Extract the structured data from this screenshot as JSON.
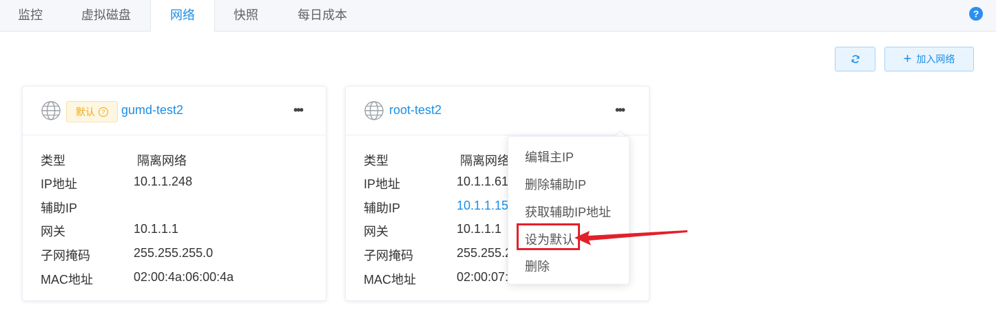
{
  "tabs": [
    {
      "label": "监控",
      "active": false
    },
    {
      "label": "虚拟磁盘",
      "active": false
    },
    {
      "label": "网络",
      "active": true
    },
    {
      "label": "快照",
      "active": false
    },
    {
      "label": "每日成本",
      "active": false
    }
  ],
  "help_icon": "question-circle-icon",
  "toolbar": {
    "refresh_icon": "refresh-icon",
    "add_network_label": "加入网络"
  },
  "cards": [
    {
      "badge": "默认",
      "name": "gumd-test2",
      "fields": {
        "type_label": "类型",
        "type_value": "隔离网络",
        "ip_label": "IP地址",
        "ip_value": "10.1.1.248",
        "aux_ip_label": "辅助IP",
        "aux_ip_value": "",
        "gateway_label": "网关",
        "gateway_value": "10.1.1.1",
        "netmask_label": "子网掩码",
        "netmask_value": "255.255.255.0",
        "mac_label": "MAC地址",
        "mac_value": "02:00:4a:06:00:4a"
      }
    },
    {
      "name": "root-test2",
      "fields": {
        "type_label": "类型",
        "type_value": "隔离网络",
        "ip_label": "IP地址",
        "ip_value": "10.1.1.61",
        "aux_ip_label": "辅助IP",
        "aux_ip_value": "10.1.1.15",
        "gateway_label": "网关",
        "gateway_value": "10.1.1.1",
        "netmask_label": "子网掩码",
        "netmask_value": "255.255.2",
        "mac_label": "MAC地址",
        "mac_value": "02:00:07:"
      }
    }
  ],
  "menu": {
    "items": [
      "编辑主IP",
      "删除辅助IP",
      "获取辅助IP地址",
      "设为默认",
      "删除"
    ]
  },
  "colors": {
    "accent": "#1a8ee8",
    "badge_text": "#f0a81c",
    "highlight": "#e3202a"
  }
}
